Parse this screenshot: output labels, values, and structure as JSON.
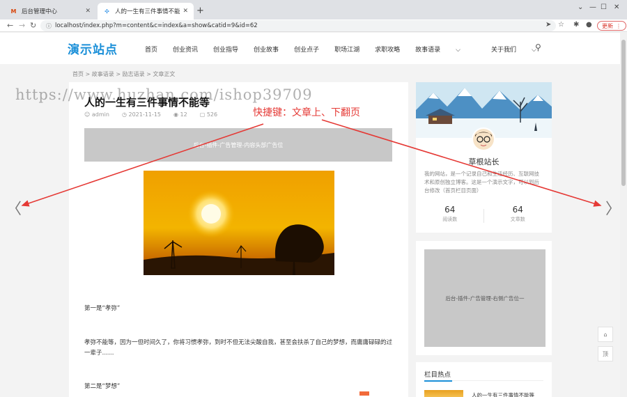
{
  "browser": {
    "tabs": [
      {
        "title": "后台管理中心",
        "favicon": "M"
      },
      {
        "title": "人的一生有三件事情不能等 - 故…",
        "favicon": "✣"
      }
    ],
    "new_tab": "+",
    "url": "localhost/index.php?m=content&c=index&a=show&catid=9&id=62",
    "update_label": "更新"
  },
  "site": {
    "logo": "演示站点",
    "nav": [
      "首页",
      "创业资讯",
      "创业指导",
      "创业故事",
      "创业点子",
      "职场江湖",
      "求职攻略",
      "故事语录",
      "关于我们"
    ],
    "active_nav": "故事语录",
    "dropdown_suffix": "⌵"
  },
  "breadcrumb": "首页 > 故事语录 > 励志语录 > 文章正文",
  "article": {
    "title": "人的一生有三件事情不能等",
    "author": "admin",
    "date": "2021-11-15",
    "views": "12",
    "comments": "526",
    "ad_text": "后台-插件-广告管理-内容头部广告位",
    "p1": "第一是“孝弥”",
    "p2": "孝弥不能等，因为一但时间久了，你将习惯孝弥，到时不但无法尖酸自我，甚至会扶杀了自己的梦想，而庸庸碌碌的过一辈子……",
    "p3": "第二是“梦想”"
  },
  "sidebar": {
    "profile": {
      "name": "草根站长",
      "desc": "我的网站，是一个记录自己和生活经历、互联网技术和原创独立博客。这是一个演示文字，可以到后台修改（首页栏目页面）",
      "stats": [
        {
          "num": "64",
          "label": "阅读数"
        },
        {
          "num": "64",
          "label": "文章数"
        }
      ]
    },
    "ad_text": "后台-插件-广告管理-右侧广告位一",
    "hot_title": "栏目热点",
    "hot_item": "人的一生有三件事情不能等"
  },
  "overlay": {
    "watermark": "https://www.huzhan.com/ishop39709",
    "hint": "快捷键：文章上、下翻页"
  },
  "float_buttons": [
    "⌂",
    "顶"
  ],
  "colors": {
    "accent": "#1a8fd8",
    "hint_red": "#e53935"
  }
}
